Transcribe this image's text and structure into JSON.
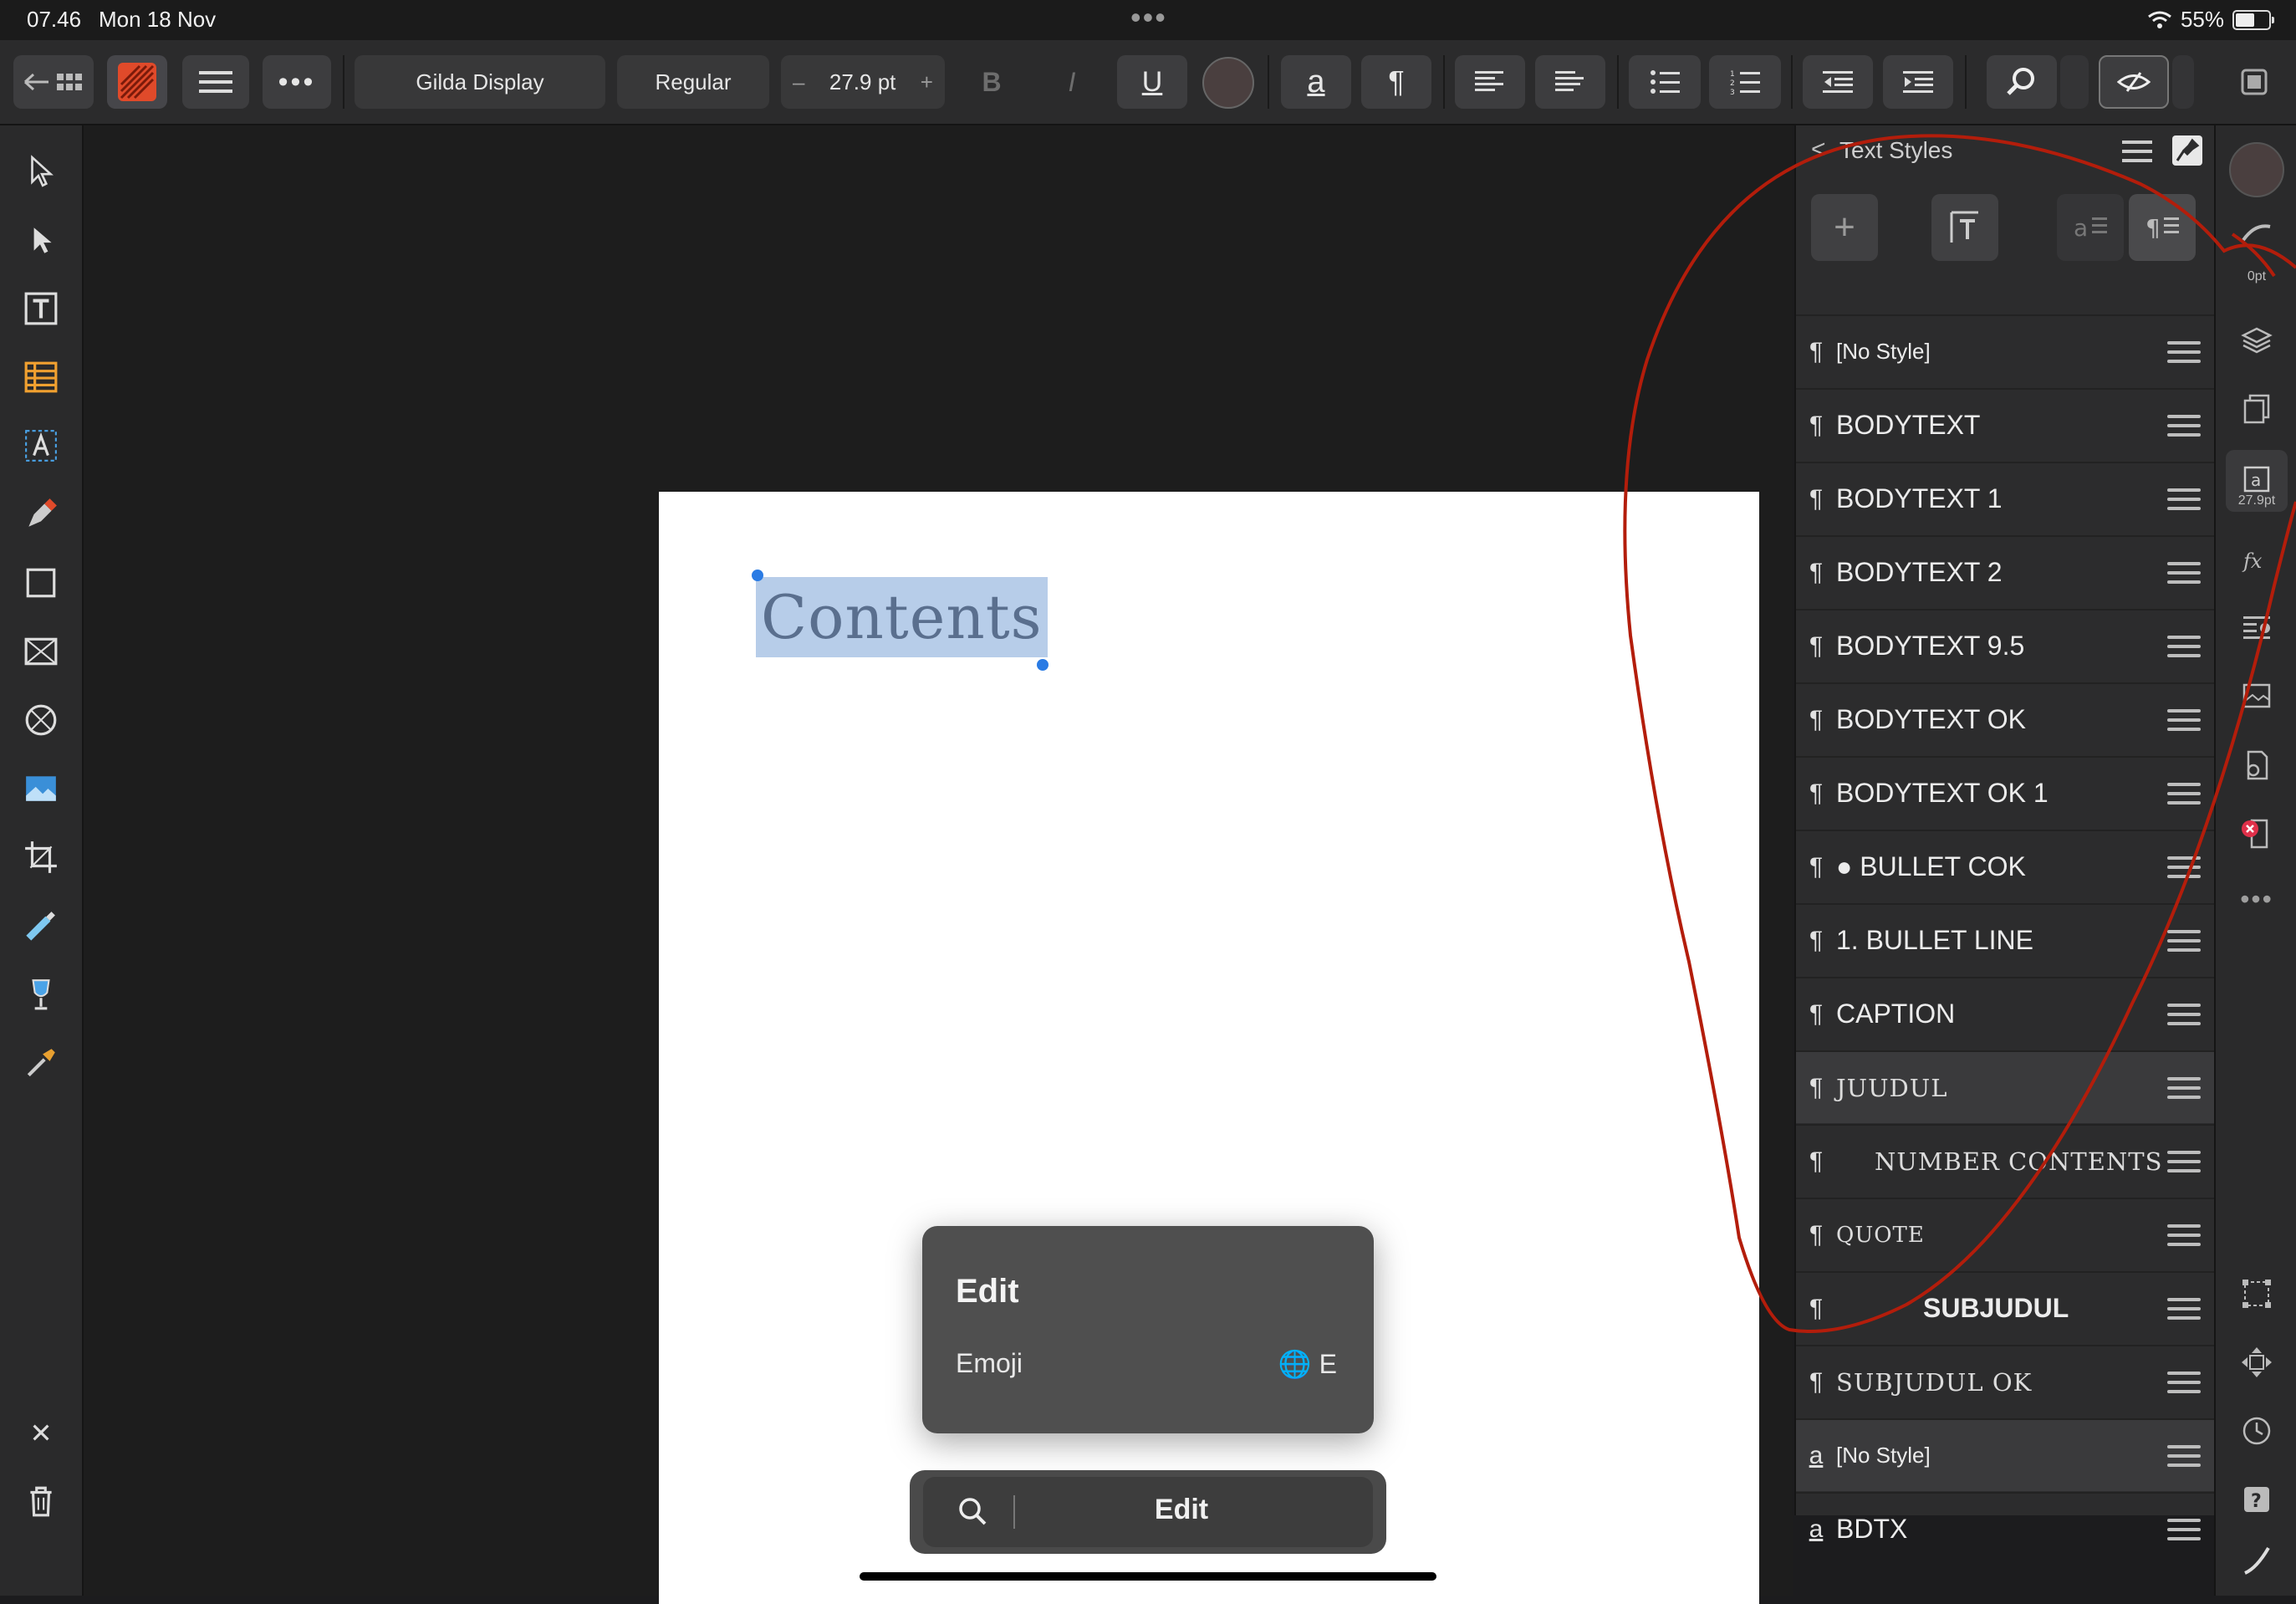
{
  "status_bar": {
    "time": "07.46",
    "date": "Mon 18 Nov",
    "battery": "55%"
  },
  "toolbar": {
    "font_family": "Gilda Display",
    "font_style": "Regular",
    "font_size": "27.9 pt",
    "minus": "–",
    "plus": "+",
    "bold": "B",
    "italic": "I",
    "underline": "U",
    "char_style_glyph": "a",
    "para_glyph": "¶",
    "text_color": "#4a3f3f"
  },
  "canvas": {
    "text": "Contents"
  },
  "panel": {
    "title": "Text Styles",
    "back": "<",
    "styles": [
      {
        "marker": "¶",
        "label": "[No Style]",
        "kind": "sans-small",
        "selected": false
      },
      {
        "marker": "¶",
        "label": "BODYTEXT",
        "kind": "sans",
        "selected": false
      },
      {
        "marker": "¶",
        "label": "BODYTEXT 1",
        "kind": "sans",
        "selected": false
      },
      {
        "marker": "¶",
        "label": "BODYTEXT 2",
        "kind": "sans",
        "selected": false
      },
      {
        "marker": "¶",
        "label": "BODYTEXT 9.5",
        "kind": "sans",
        "selected": false
      },
      {
        "marker": "¶",
        "label": "BODYTEXT OK",
        "kind": "sans",
        "selected": false
      },
      {
        "marker": "¶",
        "label": "BODYTEXT OK 1",
        "kind": "sans",
        "selected": false
      },
      {
        "marker": "¶",
        "label": "● BULLET COK",
        "kind": "sans",
        "selected": false
      },
      {
        "marker": "¶",
        "label": "1.  BULLET LINE",
        "kind": "sans",
        "selected": false
      },
      {
        "marker": "¶",
        "label": "CAPTION",
        "kind": "sans",
        "selected": false
      },
      {
        "marker": "¶",
        "label": "JUUDUL",
        "kind": "serif",
        "selected": true
      },
      {
        "marker": "¶",
        "label": "NUMBER CONTENTS",
        "kind": "serif-indent",
        "selected": false
      },
      {
        "marker": "¶",
        "label": "QUOTE",
        "kind": "serif-small",
        "selected": false
      },
      {
        "marker": "¶",
        "label": "SUBJUDUL",
        "kind": "bold-center",
        "selected": false
      },
      {
        "marker": "¶",
        "label": "SUBJUDUL OK",
        "kind": "serif",
        "selected": false
      },
      {
        "marker": "a",
        "label": "[No Style]",
        "kind": "sans-small",
        "selected": true
      },
      {
        "marker": "a",
        "label": "BDTX",
        "kind": "sans",
        "selected": false
      }
    ]
  },
  "right_strip": {
    "stroke_label": "0pt",
    "size_label": "27.9pt"
  },
  "edit_popup": {
    "title": "Edit",
    "item": "Emoji",
    "shortcut": "🌐 E"
  },
  "edit_bar": {
    "label": "Edit"
  },
  "colors": {
    "accent": "#2a7be4",
    "selection": "#b7cde9",
    "annotation": "#b31d0b"
  }
}
